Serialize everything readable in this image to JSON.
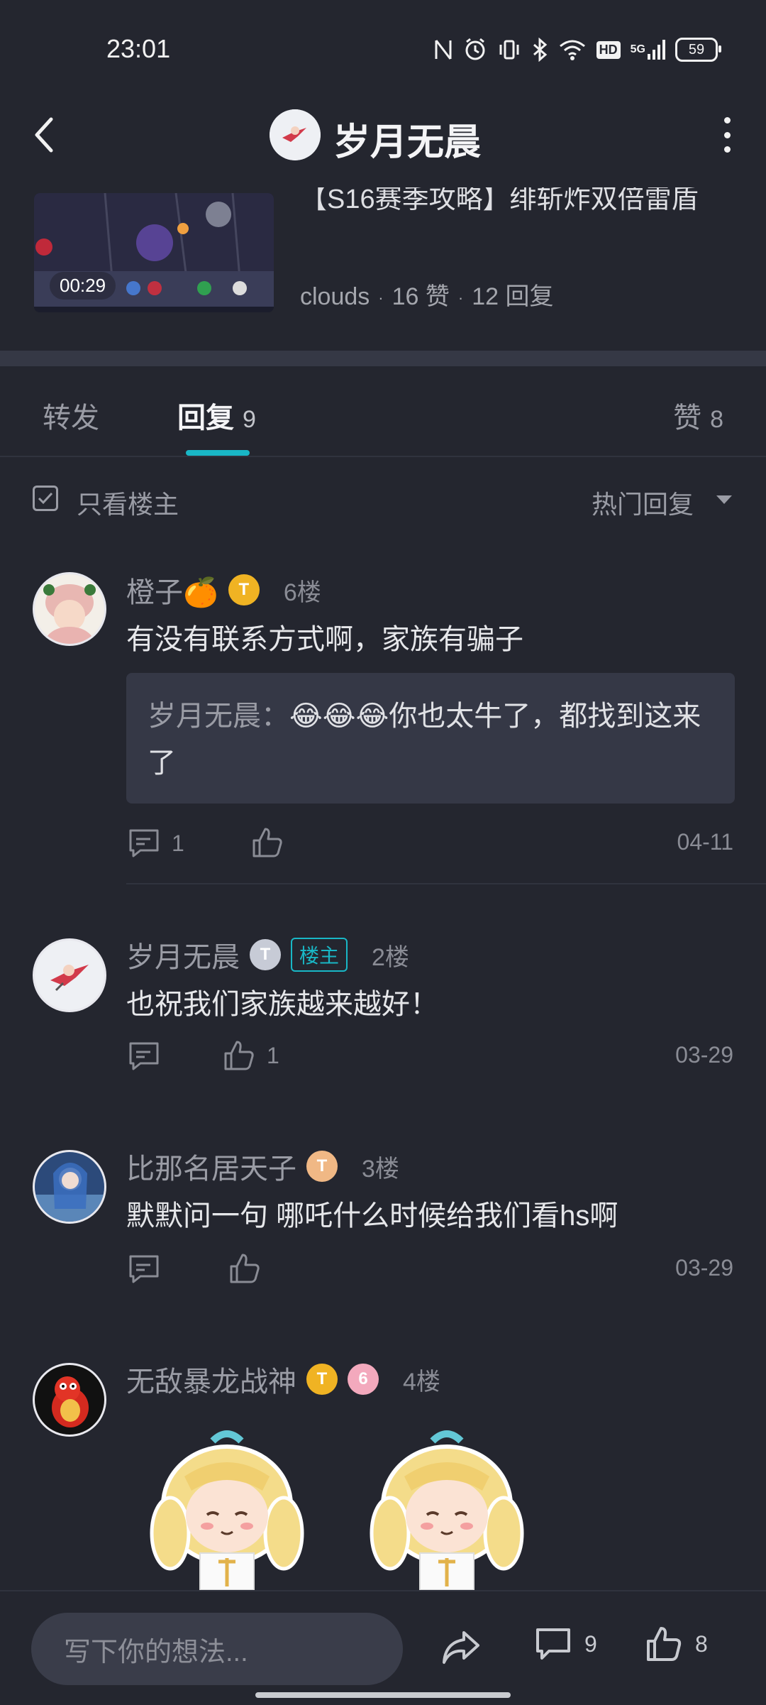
{
  "status_bar": {
    "time": "23:01",
    "battery": "59",
    "network": "5G",
    "hd": "HD"
  },
  "header": {
    "title": "岁月无晨"
  },
  "post": {
    "title": "【S16赛季攻略】绯斩炸双倍雷盾",
    "duration": "00:29",
    "author": "clouds",
    "likes": "16 赞",
    "replies": "12 回复"
  },
  "tabs": {
    "forward": "转发",
    "reply": {
      "label": "回复",
      "count": "9"
    },
    "like": {
      "label": "赞",
      "count": "8"
    }
  },
  "filter": {
    "only_op": "只看楼主",
    "sort": "热门回复"
  },
  "comments": [
    {
      "name": "橙子🍊",
      "floor": "6楼",
      "text": "有没有联系方式啊，家族有骗子",
      "quote_author": "岁月无晨：",
      "quote_text": "😂😂😂你也太牛了，都找到这来了",
      "reply_count": "1",
      "like_count": "",
      "date": "04-11"
    },
    {
      "name": "岁月无晨",
      "op_tag": "楼主",
      "floor": "2楼",
      "text": "也祝我们家族越来越好！",
      "reply_count": "",
      "like_count": "1",
      "date": "03-29"
    },
    {
      "name": "比那名居天子",
      "floor": "3楼",
      "text": "默默问一句   哪吒什么时候给我们看hs啊",
      "reply_count": "",
      "like_count": "",
      "date": "03-29"
    },
    {
      "name": "无敌暴龙战神",
      "floor": "4楼"
    }
  ],
  "bottom_bar": {
    "placeholder": "写下你的想法...",
    "comment_count": "9",
    "like_count": "8"
  },
  "colors": {
    "accent": "#19b7c6",
    "background": "#24262f",
    "card": "#353846"
  }
}
